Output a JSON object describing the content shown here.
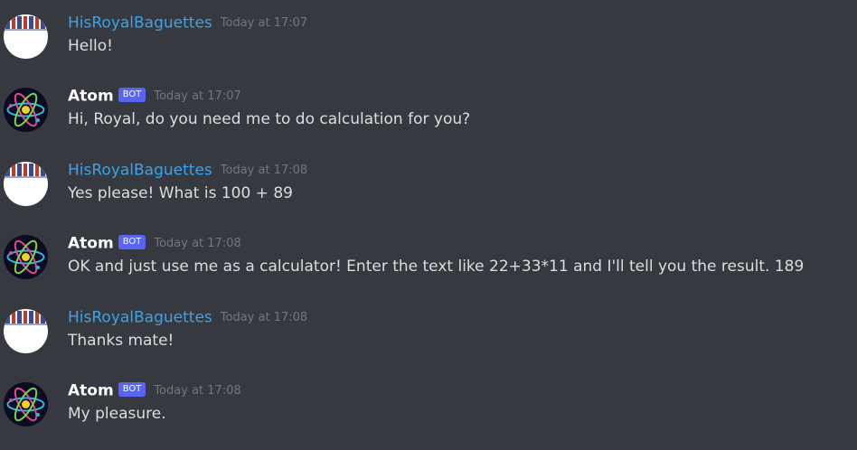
{
  "users": {
    "royal": {
      "name": "HisRoyalBaguettes",
      "color": "#3ea2e8"
    },
    "atom": {
      "name": "Atom",
      "bot_tag": "BOT",
      "color": "#ffffff"
    }
  },
  "messages": [
    {
      "author": "HisRoyalBaguettes",
      "timestamp": "Today at 17:07",
      "text": "Hello!"
    },
    {
      "author": "Atom",
      "bot_tag": "BOT",
      "timestamp": "Today at 17:07",
      "text": "Hi, Royal, do you need me to do calculation for you?"
    },
    {
      "author": "HisRoyalBaguettes",
      "timestamp": "Today at 17:08",
      "text": "Yes please! What is 100 + 89"
    },
    {
      "author": "Atom",
      "bot_tag": "BOT",
      "timestamp": "Today at 17:08",
      "text": "OK and just use me as a calculator! Enter the text like 22+33*11 and I'll tell you the result. 189"
    },
    {
      "author": "HisRoyalBaguettes",
      "timestamp": "Today at 17:08",
      "text": "Thanks mate!"
    },
    {
      "author": "Atom",
      "bot_tag": "BOT",
      "timestamp": "Today at 17:08",
      "text": "My pleasure."
    }
  ],
  "colors": {
    "background": "#36393f",
    "message_text": "#dcddde",
    "timestamp": "#72767d",
    "bot_tag_bg": "#5865f2"
  },
  "icons": {
    "royal_avatar": "baguette-banner-avatar",
    "atom_avatar": "atom-icon"
  }
}
